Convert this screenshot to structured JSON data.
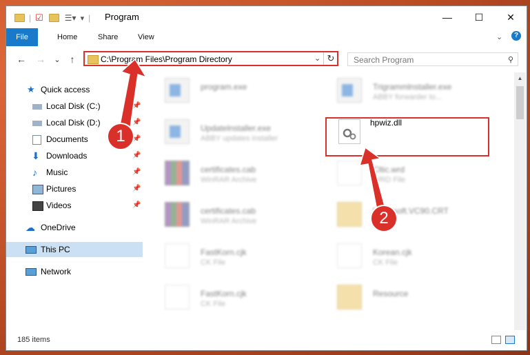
{
  "window": {
    "title": "Program",
    "controls": {
      "minimize": "—",
      "maximize": "☐",
      "close": "✕"
    }
  },
  "ribbon": {
    "tabs": [
      "File",
      "Home",
      "Share",
      "View"
    ],
    "expand_icon": "chevron-down-icon",
    "help_icon": "help-icon"
  },
  "navigation": {
    "back_icon": "←",
    "forward_icon": "→",
    "recent_icon": "⌄",
    "up_icon": "↑",
    "address": "C:\\Program Files\\Program Directory",
    "refresh_icon": "↻",
    "search_placeholder": "Search Program"
  },
  "sidebar": {
    "items": [
      {
        "label": "Quick access",
        "icon": "star-icon",
        "pinned": false
      },
      {
        "label": "Local Disk (C:)",
        "icon": "drive-icon",
        "pinned": true
      },
      {
        "label": "Local Disk (D:)",
        "icon": "drive-icon",
        "pinned": true
      },
      {
        "label": "Documents",
        "icon": "documents-icon",
        "pinned": true
      },
      {
        "label": "Downloads",
        "icon": "downloads-icon",
        "pinned": true
      },
      {
        "label": "Music",
        "icon": "music-icon",
        "pinned": true
      },
      {
        "label": "Pictures",
        "icon": "pictures-icon",
        "pinned": true
      },
      {
        "label": "Videos",
        "icon": "videos-icon",
        "pinned": true
      },
      {
        "label": "OneDrive",
        "icon": "onedrive-icon",
        "pinned": false
      },
      {
        "label": "This PC",
        "icon": "computer-icon",
        "pinned": false,
        "selected": true
      },
      {
        "label": "Network",
        "icon": "network-icon",
        "pinned": false
      }
    ]
  },
  "files": [
    {
      "name": "program.exe",
      "type": "",
      "icon": "program-exe-icon"
    },
    {
      "name": "Trigrammlnstaller.exe",
      "type": "ABBY forwarder to...",
      "icon": "installer-icon"
    },
    {
      "name": "Updatelnstaller.exe",
      "type": "ABBY updates installer",
      "icon": "installer-icon"
    },
    {
      "name": "hpwiz.dll",
      "type": "",
      "icon": "dll-gear-icon",
      "highlighted": true
    },
    {
      "name": "certificates.cab",
      "type": "WinRAR Archive",
      "icon": "winrar-icon"
    },
    {
      "name": "Cltic.wrd",
      "type": "WRD File",
      "icon": "document-icon"
    },
    {
      "name": "certificates.cab",
      "type": "WinRAR Archive",
      "icon": "winrar-icon"
    },
    {
      "name": "Microsoft.VC90.CRT",
      "type": "",
      "icon": "folder-icon"
    },
    {
      "name": "FastKorn.cjk",
      "type": "CK File",
      "icon": "document-icon"
    },
    {
      "name": "Korean.cjk",
      "type": "CK File",
      "icon": "document-icon"
    },
    {
      "name": "FastKorn.cjk",
      "type": "CK File",
      "icon": "document-icon"
    },
    {
      "name": "Resource",
      "type": "",
      "icon": "folder-icon"
    }
  ],
  "status": {
    "items_count": "185 items"
  },
  "callouts": [
    "1",
    "2"
  ],
  "colors": {
    "highlight": "#d9302a",
    "file_tab": "#1979ca",
    "selected": "#cce0f4"
  }
}
